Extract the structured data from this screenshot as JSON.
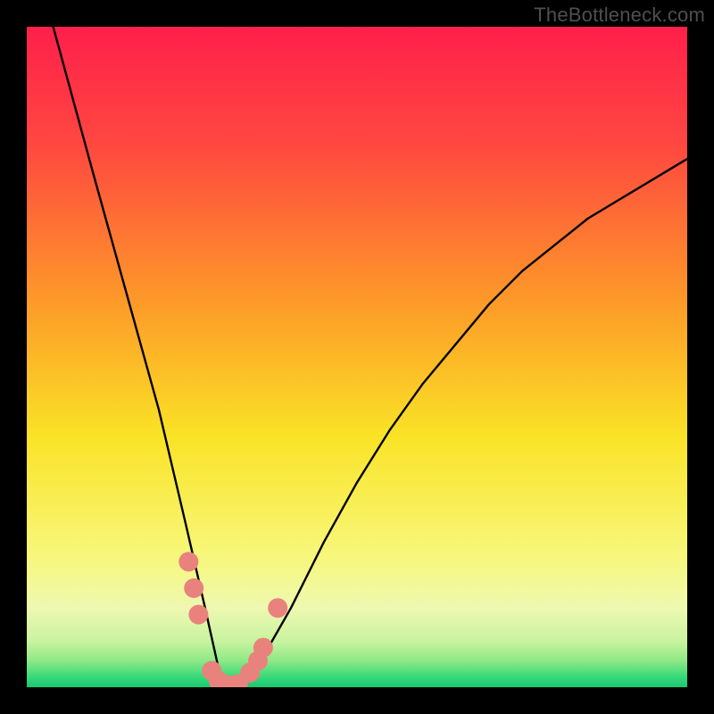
{
  "watermark": "TheBottleneck.com",
  "chart_data": {
    "type": "line",
    "title": "",
    "xlabel": "",
    "ylabel": "",
    "xlim": [
      0,
      100
    ],
    "ylim": [
      0,
      100
    ],
    "grid": false,
    "legend": false,
    "series": [
      {
        "name": "bottleneck-curve",
        "x": [
          4,
          10,
          15,
          20,
          24,
          27,
          29,
          30,
          32,
          34,
          36,
          40,
          45,
          50,
          55,
          60,
          65,
          70,
          75,
          80,
          85,
          90,
          95,
          100
        ],
        "y": [
          100,
          78,
          60,
          42,
          25,
          12,
          3,
          0,
          0,
          2,
          5,
          12,
          22,
          31,
          39,
          46,
          52,
          58,
          63,
          67,
          71,
          74,
          77,
          80
        ]
      }
    ],
    "highlighted_points": {
      "name": "marked-dots",
      "color": "#e9827d",
      "points": [
        {
          "x": 24.5,
          "y": 19
        },
        {
          "x": 25.3,
          "y": 15
        },
        {
          "x": 26.0,
          "y": 11
        },
        {
          "x": 28.0,
          "y": 2.5
        },
        {
          "x": 29.0,
          "y": 1.0
        },
        {
          "x": 30.0,
          "y": 0.3
        },
        {
          "x": 30.8,
          "y": 0.3
        },
        {
          "x": 32.0,
          "y": 0.5
        },
        {
          "x": 33.8,
          "y": 2.2
        },
        {
          "x": 35.0,
          "y": 4.0
        },
        {
          "x": 35.8,
          "y": 6.0
        },
        {
          "x": 38.0,
          "y": 12.0
        }
      ]
    },
    "background_gradient": {
      "orientation": "vertical",
      "stops": [
        {
          "pos": 0.0,
          "color": "#ff1f4b"
        },
        {
          "pos": 0.18,
          "color": "#ff4840"
        },
        {
          "pos": 0.42,
          "color": "#fd9b28"
        },
        {
          "pos": 0.62,
          "color": "#fae326"
        },
        {
          "pos": 0.8,
          "color": "#f7f77a"
        },
        {
          "pos": 0.88,
          "color": "#eef8b0"
        },
        {
          "pos": 0.93,
          "color": "#c9f3a0"
        },
        {
          "pos": 0.96,
          "color": "#8ee985"
        },
        {
          "pos": 0.985,
          "color": "#36d87a"
        },
        {
          "pos": 1.0,
          "color": "#18c76f"
        }
      ]
    }
  }
}
